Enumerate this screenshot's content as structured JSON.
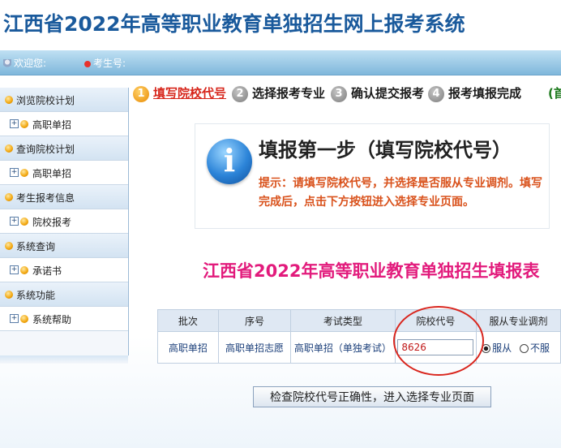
{
  "header": {
    "title": "江西省2022年高等职业教育单独招生网上报考系统"
  },
  "userbar": {
    "welcome": "欢迎您:",
    "welcome_value": "",
    "candidate_label": "考生号:",
    "candidate_value": ""
  },
  "sidebar": {
    "groups": [
      {
        "label": "浏览院校计划",
        "item": "高职单招"
      },
      {
        "label": "查询院校计划",
        "item": "高职单招"
      },
      {
        "label": "考生报考信息",
        "item": "院校报考"
      },
      {
        "label": "系统查询",
        "item": "承诺书"
      },
      {
        "label": "系统功能",
        "item": "系统帮助"
      }
    ]
  },
  "steps": [
    {
      "num": "1",
      "label": "填写院校代号",
      "active": true
    },
    {
      "num": "2",
      "label": "选择报考专业",
      "active": false
    },
    {
      "num": "3",
      "label": "确认提交报考",
      "active": false
    },
    {
      "num": "4",
      "label": "报考填报完成",
      "active": false
    }
  ],
  "steps_home": "(首",
  "info": {
    "title": "填报第一步（填写院校代号）",
    "tip": "提示：请填写院校代号，并选择是否服从专业调剂。填写完成后，点击下方按钮进入选择专业页面。"
  },
  "form": {
    "title": "江西省2022年高等职业教育单独招生填报表",
    "headers": [
      "批次",
      "序号",
      "考试类型",
      "院校代号",
      "服从专业调剂"
    ],
    "row": {
      "batch": "高职单招",
      "seq": "高职单招志愿",
      "exam_type": "高职单招（单独考试）",
      "school_code": "8626",
      "obey_yes": "服从",
      "obey_no": "不服"
    }
  },
  "submit": {
    "label": "检查院校代号正确性，进入选择专业页面"
  },
  "colors": {
    "title_blue": "#1a5a9c",
    "accent_red": "#d7261b",
    "form_title_pink": "#e21b7c",
    "tip_orange": "#d9521c"
  },
  "icons": [
    "person-icon",
    "candidate-dot-icon",
    "orange-circle-icon",
    "expand-plus-icon",
    "info-icon"
  ]
}
